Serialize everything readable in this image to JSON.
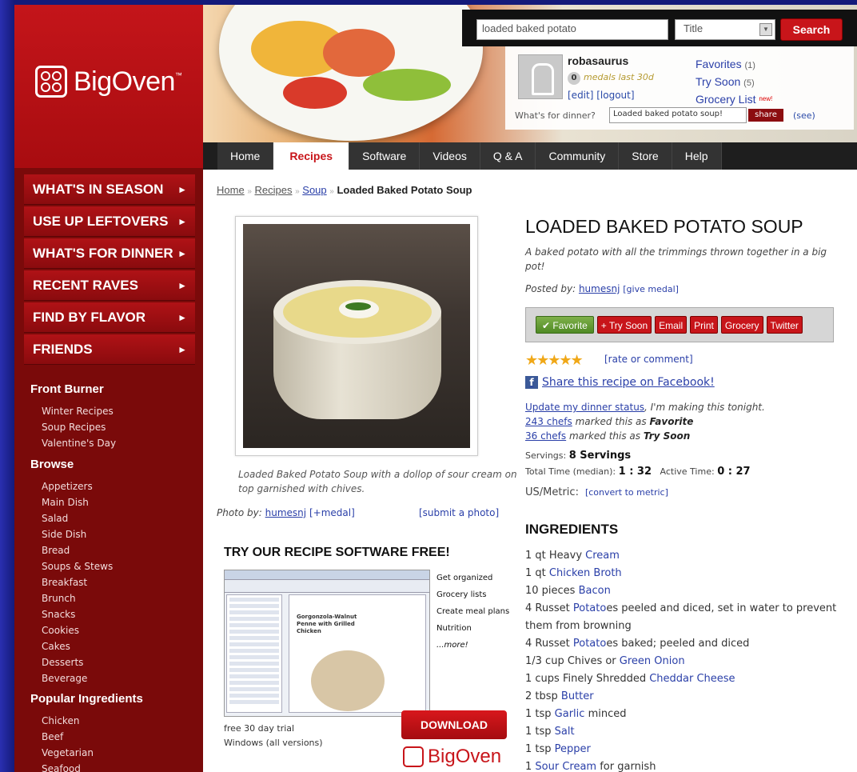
{
  "brand": {
    "name": "BigOven",
    "tm": "™"
  },
  "search": {
    "value": "loaded baked potato",
    "select": "Title",
    "button": "Search"
  },
  "user": {
    "name": "robasaurus",
    "medals_count": "0",
    "medals_text": "medals last 30d",
    "edit": "[edit]",
    "logout": "[logout]",
    "links": [
      {
        "label": "Favorites",
        "count": "(1)"
      },
      {
        "label": "Try Soon",
        "count": "(5)"
      },
      {
        "label": "Grocery List",
        "badge": "new!"
      }
    ],
    "dinner_label": "What's for dinner?",
    "dinner_value": "Loaded baked potato soup!",
    "share": "share",
    "see": "(see)"
  },
  "topnav": [
    "Home",
    "Recipes",
    "Software",
    "Videos",
    "Q & A",
    "Community",
    "Store",
    "Help"
  ],
  "sidenav": [
    "WHAT'S IN SEASON",
    "USE UP LEFTOVERS",
    "WHAT'S FOR DINNER",
    "RECENT RAVES",
    "FIND BY FLAVOR",
    "FRIENDS"
  ],
  "sidenav_arrow": "►",
  "front_burner": {
    "title": "Front Burner",
    "items": [
      "Winter Recipes",
      "Soup Recipes",
      "Valentine's Day"
    ]
  },
  "browse": {
    "title": "Browse",
    "items": [
      "Appetizers",
      "Main Dish",
      "Salad",
      "Side Dish",
      "Bread",
      "Soups & Stews",
      "Breakfast",
      "Brunch",
      "Snacks",
      "Cookies",
      "Cakes",
      "Desserts",
      "Beverage"
    ]
  },
  "popular": {
    "title": "Popular Ingredients",
    "items": [
      "Chicken",
      "Beef",
      "Vegetarian",
      "Seafood"
    ]
  },
  "breadcrumb": {
    "home": "Home",
    "recipes": "Recipes",
    "soup": "Soup",
    "current": "Loaded Baked Potato Soup",
    "sep": "»"
  },
  "photo": {
    "caption": "Loaded Baked Potato Soup with a dollop of sour cream on top garnished with chives.",
    "by_label": "Photo by:",
    "by_user": "humesnj",
    "medal": "[+medal]",
    "submit": "[submit a photo]"
  },
  "software": {
    "heading": "TRY OUR RECIPE SOFTWARE FREE!",
    "shot_title": "Gorgonzola-Walnut Penne with Grilled Chicken",
    "features": [
      "Get organized",
      "Grocery lists",
      "Create meal plans",
      "Nutrition",
      "...more!"
    ],
    "trial": "free 30 day trial",
    "windows": "Windows (all versions)",
    "download": "DOWNLOAD",
    "logo": "BigOven"
  },
  "recipe": {
    "title": "LOADED BAKED POTATO SOUP",
    "description": "A baked potato with all the trimmings thrown together in a big pot!",
    "posted_label": "Posted by:",
    "posted_user": "humesnj",
    "give_medal": "[give medal]",
    "buttons": [
      "Favorite",
      "+ Try Soon",
      "Email",
      "Print",
      "Grocery",
      "Twitter"
    ],
    "stars": "★★★★★",
    "rate": "[rate or comment]",
    "facebook": "Share this recipe on Facebook!",
    "status_link": "Update my dinner status",
    "status_text": ", I'm making this tonight.",
    "fav_link": "243 chefs",
    "fav_text": " marked this as ",
    "fav_word": "Favorite",
    "try_link": "36 chefs",
    "try_text": " marked this as ",
    "try_word": "Try Soon",
    "servings_label": "Servings:",
    "servings_value": "8 Servings",
    "total_label": "Total Time (median):",
    "total_value": "1 : 32",
    "active_label": "Active Time:",
    "active_value": "0 : 27",
    "metric_label": "US/Metric:",
    "metric_link": "[convert to metric]",
    "ingredients_heading": "INGREDIENTS",
    "ingredients": [
      {
        "pre": "1 qt Heavy ",
        "link": "Cream",
        "post": ""
      },
      {
        "pre": "1 qt ",
        "link": "Chicken Broth",
        "post": ""
      },
      {
        "pre": "10 pieces ",
        "link": "Bacon",
        "post": ""
      },
      {
        "pre": "4 Russet ",
        "link": "Potato",
        "post": "es peeled and diced, set in water to prevent them from browning"
      },
      {
        "pre": "4 Russet ",
        "link": "Potato",
        "post": "es baked; peeled and diced"
      },
      {
        "pre": "1/3 cup Chives or ",
        "link": "Green Onion",
        "post": ""
      },
      {
        "pre": "1 cups Finely Shredded ",
        "link": "Cheddar Cheese",
        "post": ""
      },
      {
        "pre": "2 tbsp ",
        "link": "Butter",
        "post": ""
      },
      {
        "pre": "1 tsp ",
        "link": "Garlic",
        "post": " minced"
      },
      {
        "pre": "1 tsp ",
        "link": "Salt",
        "post": ""
      },
      {
        "pre": "1 tsp ",
        "link": "Pepper",
        "post": ""
      },
      {
        "pre": "1 ",
        "link": "Sour Cream",
        "post": " for garnish"
      }
    ]
  }
}
